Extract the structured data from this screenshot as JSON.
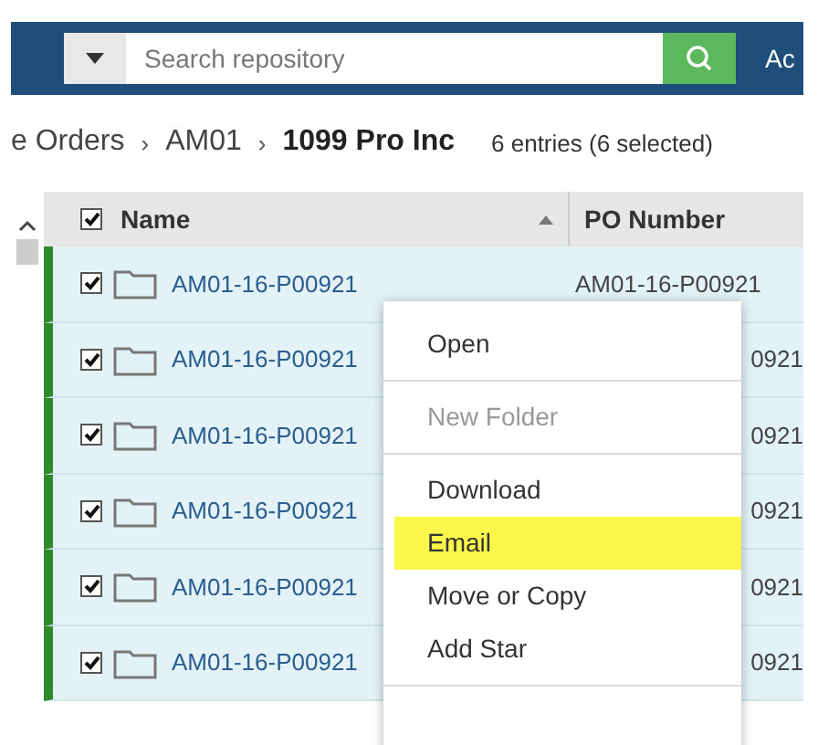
{
  "header": {
    "search": {
      "placeholder": "Search repository"
    },
    "cut_label": "Ac"
  },
  "breadcrumb": {
    "items": [
      {
        "label": "e Orders",
        "current": false
      },
      {
        "separator": "›",
        "label": "AM01",
        "current": false
      },
      {
        "separator": "›",
        "label": "1099 Pro Inc",
        "current": true
      }
    ],
    "summary": "6 entries (6 selected)"
  },
  "table": {
    "select_all": {
      "checked": true
    },
    "columns": [
      {
        "label": "Name",
        "sorted": true
      },
      {
        "label": "PO Number"
      }
    ],
    "rows": [
      {
        "name": "AM01-16-P00921",
        "po": "AM01-16-P00921",
        "selected": true
      },
      {
        "name": "AM01-16-P00921",
        "po": "0921",
        "selected": true
      },
      {
        "name": "AM01-16-P00921",
        "po": "0921",
        "selected": true
      },
      {
        "name": "AM01-16-P00921",
        "po": "0921",
        "selected": true
      },
      {
        "name": "AM01-16-P00921",
        "po": "0921",
        "selected": true
      },
      {
        "name": "AM01-16-P00921",
        "po": "0921",
        "selected": true
      }
    ]
  },
  "context_menu": {
    "groups": [
      [
        {
          "label": "Open",
          "disabled": false,
          "highlighted": false
        }
      ],
      [
        {
          "label": "New Folder",
          "disabled": true,
          "highlighted": false
        }
      ],
      [
        {
          "label": "Download",
          "disabled": false,
          "highlighted": false
        },
        {
          "label": "Email",
          "disabled": false,
          "highlighted": true
        },
        {
          "label": "Move or Copy",
          "disabled": false,
          "highlighted": false
        },
        {
          "label": "Add Star",
          "disabled": false,
          "highlighted": false
        }
      ]
    ]
  }
}
